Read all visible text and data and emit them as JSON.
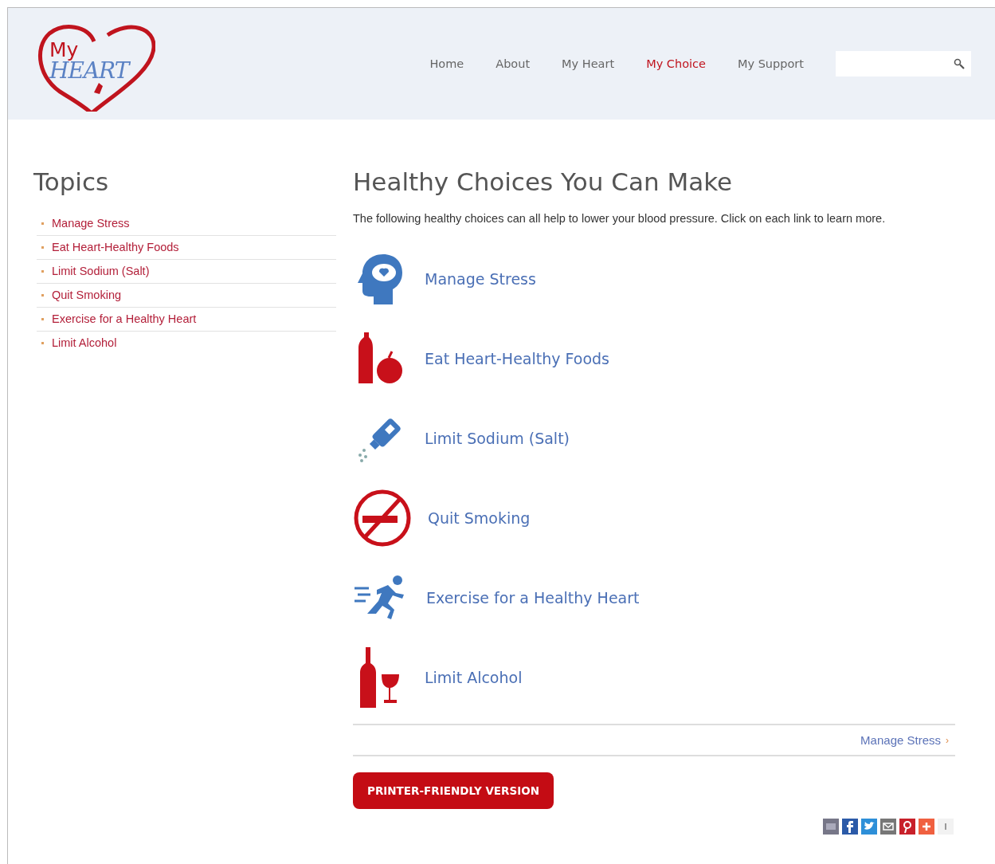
{
  "logo": {
    "top": "My",
    "bottom": "HEART"
  },
  "nav": [
    {
      "label": "Home",
      "selected": false
    },
    {
      "label": "About",
      "selected": false
    },
    {
      "label": "My Heart",
      "selected": false
    },
    {
      "label": "My Choice",
      "selected": true
    },
    {
      "label": "My Support",
      "selected": false
    }
  ],
  "sidebar": {
    "title": "Topics",
    "items": [
      "Manage Stress",
      "Eat Heart-Healthy Foods",
      "Limit Sodium (Salt)",
      "Quit Smoking",
      "Exercise for a Healthy Heart",
      "Limit Alcohol"
    ]
  },
  "main": {
    "title": "Healthy Choices You Can Make",
    "intro": "The following healthy choices can all help to lower your blood pressure. Click on each link to learn more.",
    "choices": [
      "Manage Stress",
      "Eat Heart-Healthy Foods",
      "Limit Sodium (Salt)",
      "Quit Smoking",
      "Exercise for a Healthy Heart",
      "Limit Alcohol"
    ],
    "next": {
      "label": "Manage Stress",
      "arrow": "›"
    },
    "print_button": "PRINTER-FRIENDLY VERSION"
  }
}
